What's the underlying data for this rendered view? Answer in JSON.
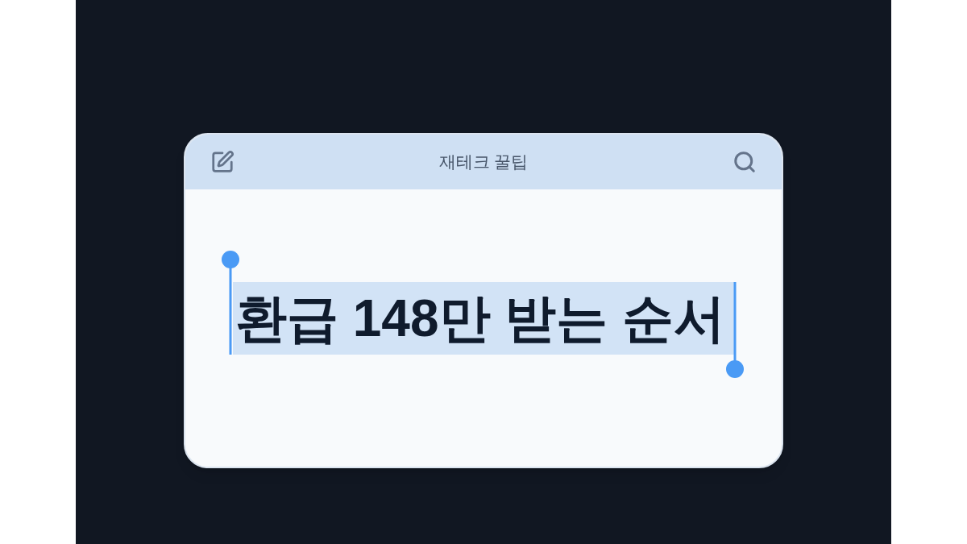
{
  "note_card": {
    "title": "재테크 꿀팁",
    "selection": {
      "text": "환급 148만 받는 순서",
      "selected": true
    }
  }
}
